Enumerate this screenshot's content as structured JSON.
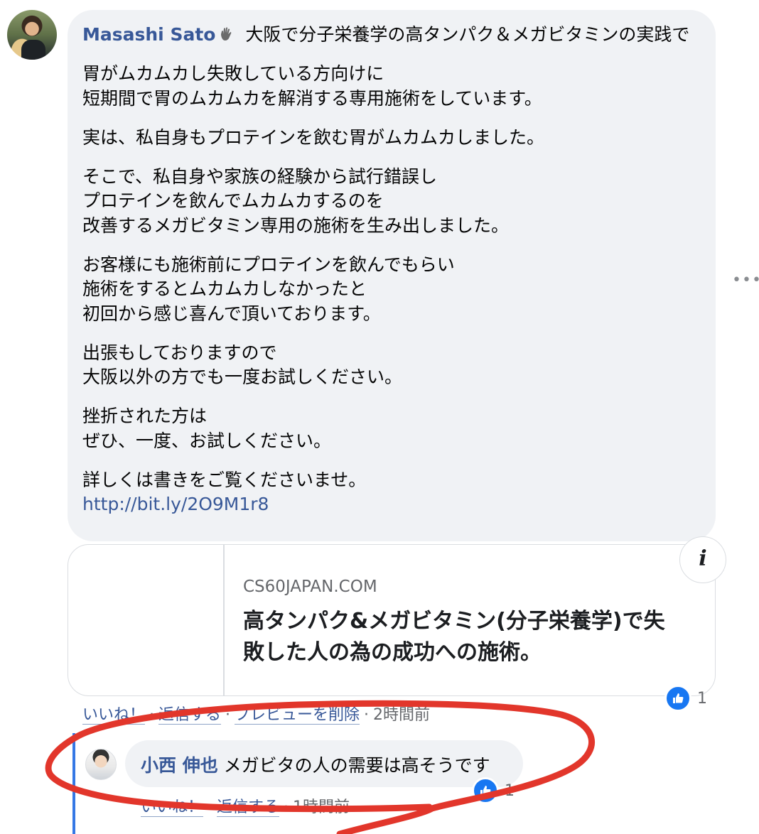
{
  "comment": {
    "author": "Masashi Sato",
    "text_lead": " 大阪で分子栄養学の高タンパク＆メガビタミンの実践で",
    "paragraphs": [
      [
        "胃がムカムカし失敗している方向けに",
        "短期間で胃のムカムカを解消する専用施術をしています。"
      ],
      [
        "実は、私自身もプロテインを飲む胃がムカムカしました。"
      ],
      [
        "そこで、私自身や家族の経験から試行錯誤し",
        "プロテインを飲んでムカムカするのを",
        "改善するメガビタミン専用の施術を生み出しました。"
      ],
      [
        "お客様にも施術前にプロテインを飲んでもらい",
        "施術をするとムカムカしなかったと",
        "初回から感じ喜んで頂いております。"
      ],
      [
        "出張もしておりますので",
        "大阪以外の方でも一度お試しください。"
      ],
      [
        "挫折された方は",
        "ぜひ、一度、お試しください。"
      ],
      [
        "詳しくは書きをご覧くださいませ。"
      ]
    ],
    "link": "http://bit.ly/2O9M1r8",
    "more_icon": "more-horizontal-icon",
    "like_count": "1",
    "actions": {
      "like": "いいね！",
      "reply": "返信する",
      "remove_preview": "プレビューを削除",
      "time": "2時間前"
    }
  },
  "link_preview": {
    "domain": "CS60JAPAN.COM",
    "title_line1": "高タンパク&メガビタミン(分子栄養学)で失",
    "title_line2": "敗した人の為の成功への施術。",
    "info_icon": "info-icon",
    "info_label": "i"
  },
  "reply": {
    "author": "小西 伸也",
    "text": " メガビタの人の需要は高そうです",
    "like_count": "1",
    "actions": {
      "like": "いいね！",
      "reply": "返信する",
      "time": "1時間前"
    }
  },
  "colors": {
    "link_blue": "#385898",
    "bubble_gray": "#f0f2f5",
    "like_blue": "#1877f2",
    "annotation_red": "#e2362b"
  }
}
